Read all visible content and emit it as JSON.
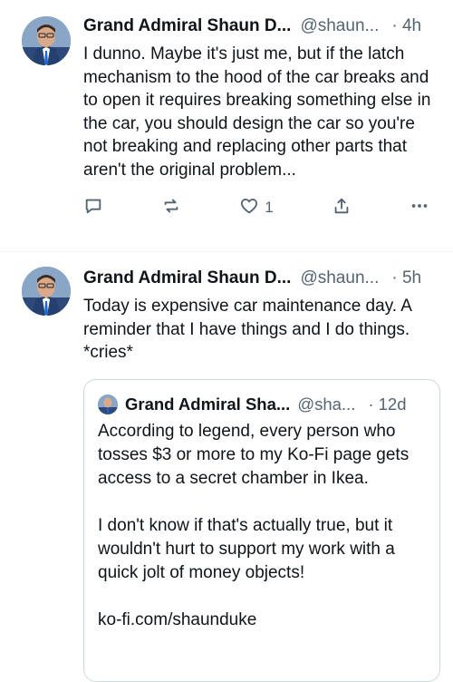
{
  "posts": [
    {
      "author": "Grand Admiral Shaun D...",
      "handle": "@shaun...",
      "time": "· 4h",
      "text": "I dunno. Maybe it's just me, but if the latch mechanism to the hood of the car breaks and to open it requires breaking something else in the car, you should design the car so you're not breaking and replacing other parts that aren't the original problem...",
      "like_count": "1"
    },
    {
      "author": "Grand Admiral Shaun D...",
      "handle": "@shaun...",
      "time": "· 5h",
      "text": "Today is expensive car maintenance day. A reminder that I have things and I do things. *cries*",
      "quote": {
        "author": "Grand Admiral Sha...",
        "handle": "@sha...",
        "time": "· 12d",
        "para1": "According to legend, every person who tosses $3 or more to my Ko-Fi page gets access to a secret chamber in Ikea.",
        "para2": "I don't know if that's actually true, but it wouldn't hurt to support my work with a quick jolt of money objects!",
        "link": "ko-fi.com/shaunduke"
      }
    }
  ],
  "icons": {
    "reply": "reply-icon",
    "repost": "repost-icon",
    "like": "heart-icon",
    "share": "share-icon",
    "more": "more-icon"
  }
}
